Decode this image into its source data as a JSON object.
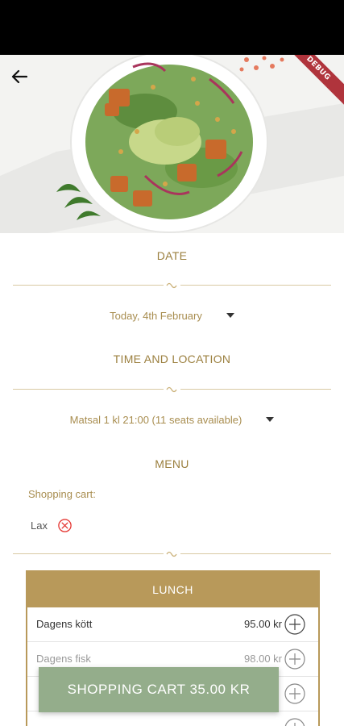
{
  "hero": {
    "debug_label": "DEBUG"
  },
  "date_section": {
    "title": "DATE",
    "selected": "Today, 4th February"
  },
  "time_section": {
    "title": "TIME AND LOCATION",
    "selected": "Matsal 1 kl 21:00 (11 seats available)"
  },
  "menu_section": {
    "title": "MENU",
    "cart_label": "Shopping cart:",
    "cart_items": [
      {
        "name": "Lax"
      }
    ]
  },
  "lunch_menu": {
    "header": "LUNCH",
    "items": [
      {
        "name": "Dagens kött",
        "price": "95.00 kr"
      },
      {
        "name": "Dagens fisk",
        "price": "98.00 kr"
      },
      {
        "name": "",
        "price": ""
      },
      {
        "name": "",
        "price": ""
      }
    ]
  },
  "cart_button": {
    "label": "SHOPPING CART 35.00 KR"
  },
  "colors": {
    "accent": "#b8995a",
    "text_gold": "#a88d4f",
    "cart_button": "#94ad8b",
    "remove": "#e53935"
  }
}
